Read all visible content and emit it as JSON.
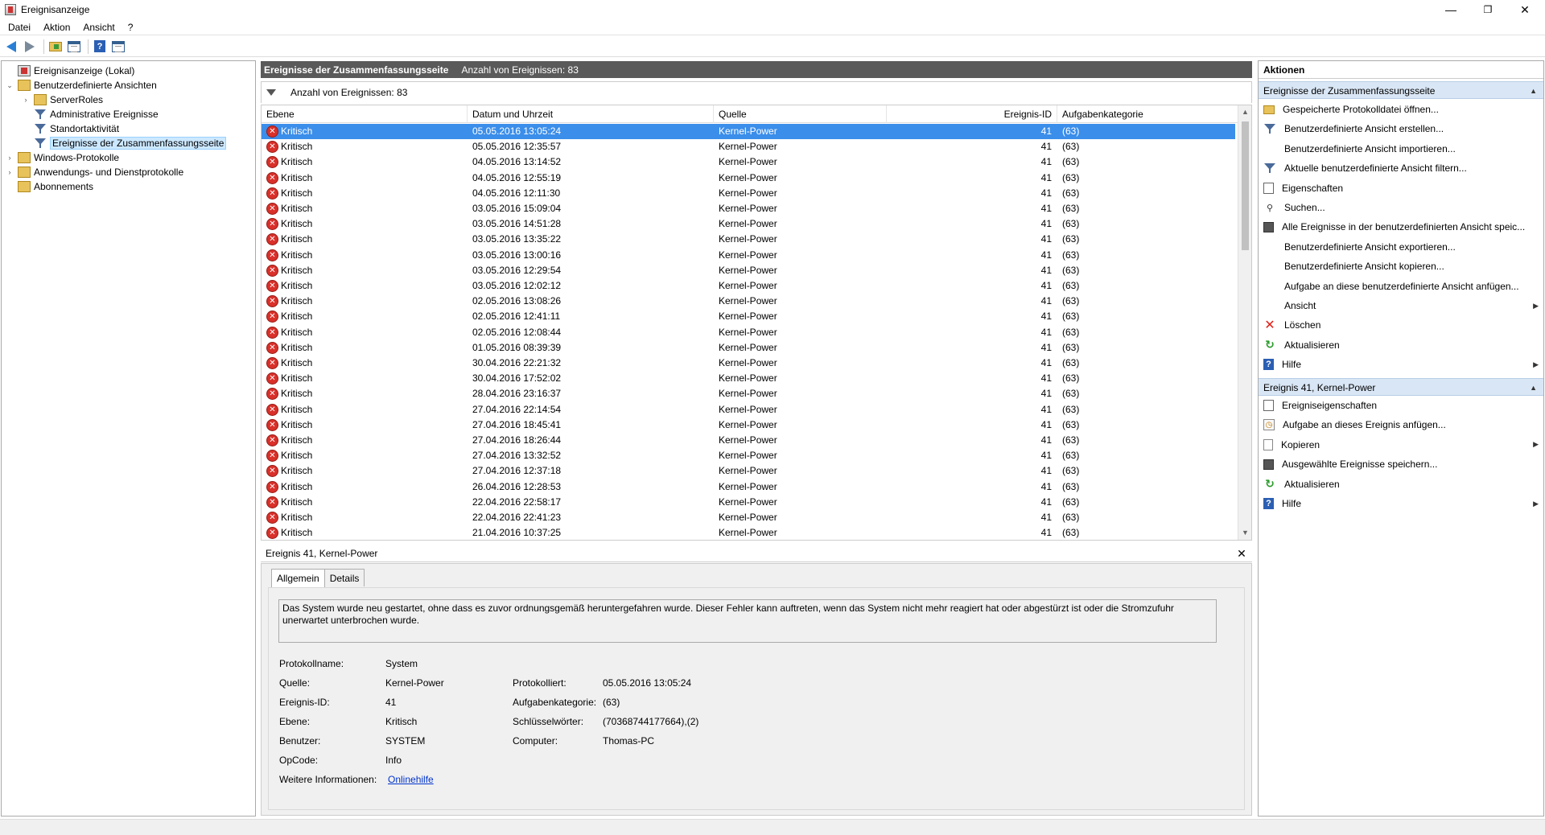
{
  "window": {
    "title": "Ereignisanzeige",
    "minimize": "—",
    "restore": "❐",
    "close": "✕"
  },
  "menu": [
    "Datei",
    "Aktion",
    "Ansicht",
    "?"
  ],
  "toolbar": {
    "icons": [
      "back-icon",
      "forward-icon",
      "up-folder-icon",
      "show-hide-tree-icon",
      "help-icon",
      "show-action-pane-icon"
    ]
  },
  "tree": [
    {
      "label": "Ereignisanzeige (Lokal)",
      "icon": "event-viewer-icon",
      "exp": ""
    },
    {
      "label": "Benutzerdefinierte Ansichten",
      "icon": "folder-icon",
      "exp": "⌄"
    },
    {
      "label": "ServerRoles",
      "icon": "folder-icon",
      "exp": "›"
    },
    {
      "label": "Administrative Ereignisse",
      "icon": "filter-icon",
      "exp": ""
    },
    {
      "label": "Standortaktivität",
      "icon": "filter-icon",
      "exp": ""
    },
    {
      "label": "Ereignisse der Zusammenfassungsseite",
      "icon": "filter-icon",
      "exp": ""
    },
    {
      "label": "Windows-Protokolle",
      "icon": "folder-icon",
      "exp": "›"
    },
    {
      "label": "Anwendungs- und Dienstprotokolle",
      "icon": "folder-icon",
      "exp": "›"
    },
    {
      "label": "Abonnements",
      "icon": "folder-icon",
      "exp": ""
    }
  ],
  "middle": {
    "title": "Ereignisse der Zusammenfassungsseite",
    "count_label": "Anzahl von Ereignissen: 83",
    "filter_count": "Anzahl von Ereignissen: 83",
    "columns": [
      "Ebene",
      "Datum und Uhrzeit",
      "Quelle",
      "Ereignis-ID",
      "Aufgabenkategorie"
    ],
    "rows": [
      {
        "level": "Kritisch",
        "date": "05.05.2016 13:05:24",
        "source": "Kernel-Power",
        "id": "41",
        "task": "(63)"
      },
      {
        "level": "Kritisch",
        "date": "05.05.2016 12:35:57",
        "source": "Kernel-Power",
        "id": "41",
        "task": "(63)"
      },
      {
        "level": "Kritisch",
        "date": "04.05.2016 13:14:52",
        "source": "Kernel-Power",
        "id": "41",
        "task": "(63)"
      },
      {
        "level": "Kritisch",
        "date": "04.05.2016 12:55:19",
        "source": "Kernel-Power",
        "id": "41",
        "task": "(63)"
      },
      {
        "level": "Kritisch",
        "date": "04.05.2016 12:11:30",
        "source": "Kernel-Power",
        "id": "41",
        "task": "(63)"
      },
      {
        "level": "Kritisch",
        "date": "03.05.2016 15:09:04",
        "source": "Kernel-Power",
        "id": "41",
        "task": "(63)"
      },
      {
        "level": "Kritisch",
        "date": "03.05.2016 14:51:28",
        "source": "Kernel-Power",
        "id": "41",
        "task": "(63)"
      },
      {
        "level": "Kritisch",
        "date": "03.05.2016 13:35:22",
        "source": "Kernel-Power",
        "id": "41",
        "task": "(63)"
      },
      {
        "level": "Kritisch",
        "date": "03.05.2016 13:00:16",
        "source": "Kernel-Power",
        "id": "41",
        "task": "(63)"
      },
      {
        "level": "Kritisch",
        "date": "03.05.2016 12:29:54",
        "source": "Kernel-Power",
        "id": "41",
        "task": "(63)"
      },
      {
        "level": "Kritisch",
        "date": "03.05.2016 12:02:12",
        "source": "Kernel-Power",
        "id": "41",
        "task": "(63)"
      },
      {
        "level": "Kritisch",
        "date": "02.05.2016 13:08:26",
        "source": "Kernel-Power",
        "id": "41",
        "task": "(63)"
      },
      {
        "level": "Kritisch",
        "date": "02.05.2016 12:41:11",
        "source": "Kernel-Power",
        "id": "41",
        "task": "(63)"
      },
      {
        "level": "Kritisch",
        "date": "02.05.2016 12:08:44",
        "source": "Kernel-Power",
        "id": "41",
        "task": "(63)"
      },
      {
        "level": "Kritisch",
        "date": "01.05.2016 08:39:39",
        "source": "Kernel-Power",
        "id": "41",
        "task": "(63)"
      },
      {
        "level": "Kritisch",
        "date": "30.04.2016 22:21:32",
        "source": "Kernel-Power",
        "id": "41",
        "task": "(63)"
      },
      {
        "level": "Kritisch",
        "date": "30.04.2016 17:52:02",
        "source": "Kernel-Power",
        "id": "41",
        "task": "(63)"
      },
      {
        "level": "Kritisch",
        "date": "28.04.2016 23:16:37",
        "source": "Kernel-Power",
        "id": "41",
        "task": "(63)"
      },
      {
        "level": "Kritisch",
        "date": "27.04.2016 22:14:54",
        "source": "Kernel-Power",
        "id": "41",
        "task": "(63)"
      },
      {
        "level": "Kritisch",
        "date": "27.04.2016 18:45:41",
        "source": "Kernel-Power",
        "id": "41",
        "task": "(63)"
      },
      {
        "level": "Kritisch",
        "date": "27.04.2016 18:26:44",
        "source": "Kernel-Power",
        "id": "41",
        "task": "(63)"
      },
      {
        "level": "Kritisch",
        "date": "27.04.2016 13:32:52",
        "source": "Kernel-Power",
        "id": "41",
        "task": "(63)"
      },
      {
        "level": "Kritisch",
        "date": "27.04.2016 12:37:18",
        "source": "Kernel-Power",
        "id": "41",
        "task": "(63)"
      },
      {
        "level": "Kritisch",
        "date": "26.04.2016 12:28:53",
        "source": "Kernel-Power",
        "id": "41",
        "task": "(63)"
      },
      {
        "level": "Kritisch",
        "date": "22.04.2016 22:58:17",
        "source": "Kernel-Power",
        "id": "41",
        "task": "(63)"
      },
      {
        "level": "Kritisch",
        "date": "22.04.2016 22:41:23",
        "source": "Kernel-Power",
        "id": "41",
        "task": "(63)"
      },
      {
        "level": "Kritisch",
        "date": "21.04.2016 10:37:25",
        "source": "Kernel-Power",
        "id": "41",
        "task": "(63)"
      }
    ]
  },
  "detail": {
    "title": "Ereignis 41, Kernel-Power",
    "close": "✕",
    "tabs": [
      "Allgemein",
      "Details"
    ],
    "description": "Das System wurde neu gestartet, ohne dass es zuvor ordnungsgemäß heruntergefahren wurde. Dieser Fehler kann auftreten, wenn das System nicht mehr reagiert hat oder abgestürzt ist oder die Stromzufuhr unerwartet unterbrochen wurde.",
    "fields": {
      "protokollname_label": "Protokollname:",
      "protokollname": "System",
      "quelle_label": "Quelle:",
      "quelle": "Kernel-Power",
      "protokolliert_label": "Protokolliert:",
      "protokolliert": "05.05.2016 13:05:24",
      "ereignis_id_label": "Ereignis-ID:",
      "ereignis_id": "41",
      "aufgabenkategorie_label": "Aufgabenkategorie:",
      "aufgabenkategorie": "(63)",
      "ebene_label": "Ebene:",
      "ebene": "Kritisch",
      "schluesselwoerter_label": "Schlüsselwörter:",
      "schluesselwoerter": "(70368744177664),(2)",
      "benutzer_label": "Benutzer:",
      "benutzer": "SYSTEM",
      "computer_label": "Computer:",
      "computer": "Thomas-PC",
      "opcode_label": "OpCode:",
      "opcode": "Info",
      "weitere_label": "Weitere Informationen:",
      "weitere_link": "Onlinehilfe"
    }
  },
  "actions": {
    "title": "Aktionen",
    "section1": "Ereignisse der Zusammenfassungsseite",
    "items1": [
      {
        "label": "Gespeicherte Protokolldatei öffnen...",
        "icon": "open-log-icon",
        "sub": ""
      },
      {
        "label": "Benutzerdefinierte Ansicht erstellen...",
        "icon": "create-view-icon",
        "sub": ""
      },
      {
        "label": "Benutzerdefinierte Ansicht importieren...",
        "icon": "",
        "sub": ""
      },
      {
        "label": "Aktuelle benutzerdefinierte Ansicht filtern...",
        "icon": "filter-icon",
        "sub": ""
      },
      {
        "label": "Eigenschaften",
        "icon": "properties-icon",
        "sub": ""
      },
      {
        "label": "Suchen...",
        "icon": "find-icon",
        "sub": ""
      },
      {
        "label": "Alle Ereignisse in der benutzerdefinierten Ansicht speic...",
        "icon": "save-icon",
        "sub": ""
      },
      {
        "label": "Benutzerdefinierte Ansicht exportieren...",
        "icon": "",
        "sub": ""
      },
      {
        "label": "Benutzerdefinierte Ansicht kopieren...",
        "icon": "",
        "sub": ""
      },
      {
        "label": "Aufgabe an diese benutzerdefinierte Ansicht anfügen...",
        "icon": "",
        "sub": ""
      },
      {
        "label": "Ansicht",
        "icon": "",
        "sub": "▶"
      },
      {
        "label": "Löschen",
        "icon": "delete-icon",
        "sub": ""
      },
      {
        "label": "Aktualisieren",
        "icon": "refresh-icon",
        "sub": ""
      },
      {
        "label": "Hilfe",
        "icon": "help-icon",
        "sub": "▶"
      }
    ],
    "section2": "Ereignis 41, Kernel-Power",
    "items2": [
      {
        "label": "Ereigniseigenschaften",
        "icon": "event-properties-icon",
        "sub": ""
      },
      {
        "label": "Aufgabe an dieses Ereignis anfügen...",
        "icon": "attach-task-icon",
        "sub": ""
      },
      {
        "label": "Kopieren",
        "icon": "copy-icon",
        "sub": "▶"
      },
      {
        "label": "Ausgewählte Ereignisse speichern...",
        "icon": "save-icon",
        "sub": ""
      },
      {
        "label": "Aktualisieren",
        "icon": "refresh-icon",
        "sub": ""
      },
      {
        "label": "Hilfe",
        "icon": "help-icon",
        "sub": "▶"
      }
    ]
  }
}
